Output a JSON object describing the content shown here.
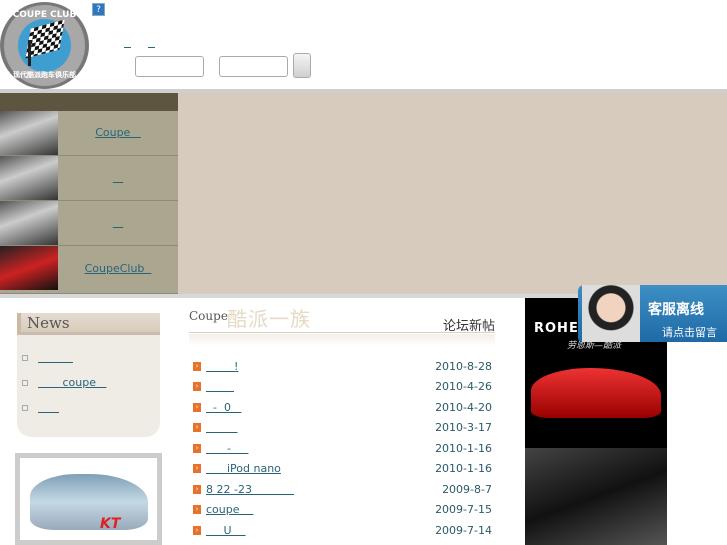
{
  "logo": {
    "top_text": "COUPE CLUB",
    "bottom_text": "现代酷派跑车俱乐部"
  },
  "header": {
    "help_icon": "?",
    "links": [
      "  ",
      "  "
    ],
    "input1": "",
    "input2": "",
    "submit_label": ""
  },
  "nav": [
    {
      "label": "Coupe   "
    },
    {
      "label": "   "
    },
    {
      "label": "   "
    },
    {
      "label": "CoupeClub  "
    }
  ],
  "news": {
    "title": "News",
    "items": [
      "          ",
      "       coupe   ",
      "      "
    ]
  },
  "forum": {
    "coupe": "Coupe",
    "brand_cn": "酷派一族",
    "heading": "论坛新帖",
    "posts": [
      {
        "title": "        !",
        "date": "2010-8-28"
      },
      {
        "title": "        ",
        "date": "2010-4-26"
      },
      {
        "title": "  -  0   ",
        "date": "2010-4-20"
      },
      {
        "title": "         ",
        "date": "2010-3-17"
      },
      {
        "title": "      -     ",
        "date": "2010-1-16"
      },
      {
        "title": "      iPod nano",
        "date": "2010-1-16"
      },
      {
        "title": "8 22 -23            ",
        "date": "2009-8-7"
      },
      {
        "title": "coupe    ",
        "date": "2009-7-15"
      },
      {
        "title": "     U    ",
        "date": "2009-7-14"
      }
    ]
  },
  "ad": {
    "brand": "ROHENS",
    "slogan": "劳恩斯—酷派"
  },
  "service": {
    "title": "客服离线",
    "subtitle": "请点击留言"
  },
  "promo": {
    "logo_text": "KT"
  }
}
